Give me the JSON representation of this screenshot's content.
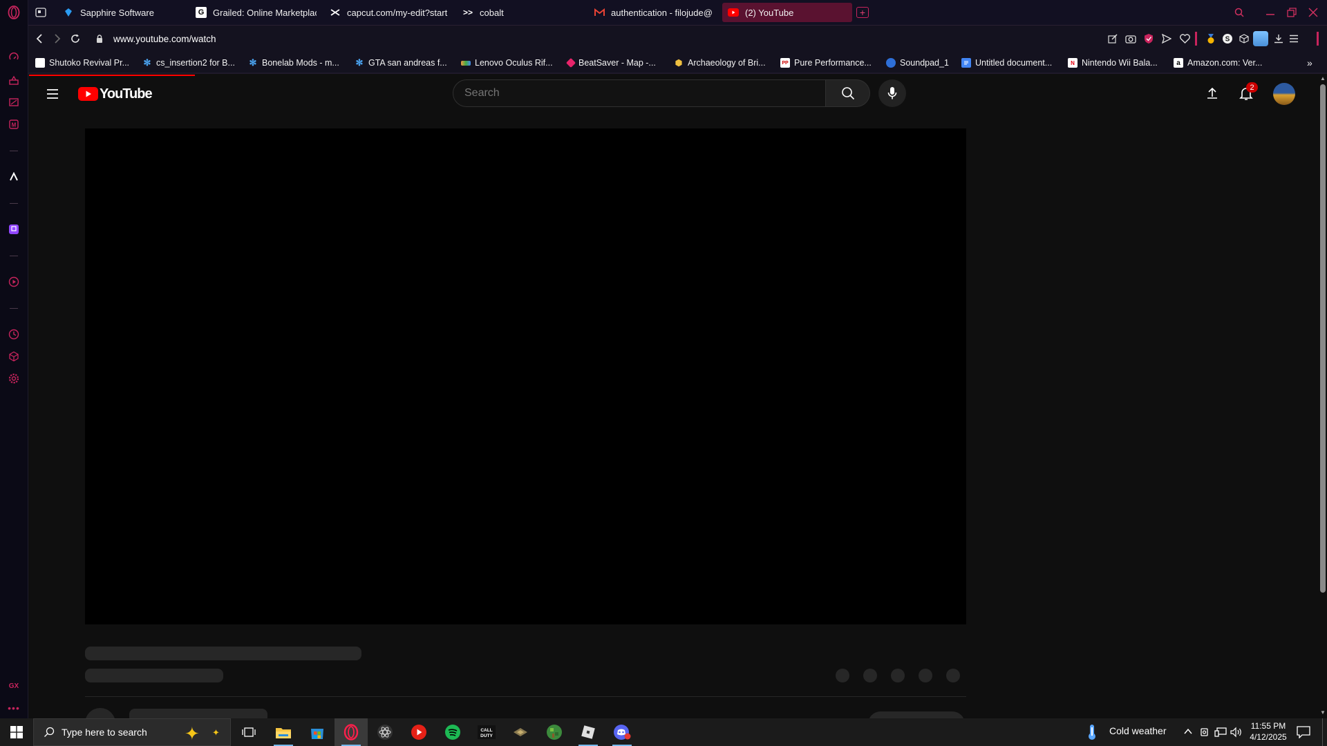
{
  "browser": {
    "tabs": [
      {
        "label": "Sapphire Software",
        "favicon": "sapphire-icon",
        "active": false
      },
      {
        "label": "Grailed: Online Marketplace",
        "favicon": "grailed-icon",
        "active": false
      },
      {
        "label": "capcut.com/my-edit?start",
        "favicon": "capcut-icon",
        "active": false
      },
      {
        "label": "cobalt",
        "favicon": "cobalt-icon",
        "active": false
      },
      {
        "label": "authentication - filojude@",
        "favicon": "gmail-icon",
        "active": false
      },
      {
        "label": "(2) YouTube",
        "favicon": "youtube-icon",
        "active": true
      }
    ],
    "address": "www.youtube.com/watch",
    "bookmarks": [
      {
        "label": "Shutoko Revival Pr...",
        "favicon": "page-icon"
      },
      {
        "label": "cs_insertion2 for B...",
        "favicon": "gear-icon"
      },
      {
        "label": "Bonelab Mods - m...",
        "favicon": "gear-icon"
      },
      {
        "label": "GTA san andreas f...",
        "favicon": "gear-icon"
      },
      {
        "label": "Lenovo Oculus Rif...",
        "favicon": "lenovo-icon"
      },
      {
        "label": "BeatSaver - Map -...",
        "favicon": "beatsaver-icon"
      },
      {
        "label": "Archaeology of Bri...",
        "favicon": "hexagon-icon"
      },
      {
        "label": "Pure Performance...",
        "favicon": "pure-icon"
      },
      {
        "label": "Soundpad_1",
        "favicon": "soundpad-icon"
      },
      {
        "label": "Untitled document...",
        "favicon": "docs-icon"
      },
      {
        "label": "Nintendo Wii Bala...",
        "favicon": "nintendo-icon"
      },
      {
        "label": "Amazon.com: Ver...",
        "favicon": "amazon-icon"
      }
    ]
  },
  "youtube": {
    "logo_text": "YouTube",
    "search_placeholder": "Search",
    "notification_count": "2"
  },
  "taskbar": {
    "search_placeholder": "Type here to search",
    "weather": "Cold weather",
    "time": "11:55 PM",
    "date": "4/12/2025"
  },
  "colors": {
    "accent": "#d0305f",
    "youtube_red": "#ff0000",
    "page_bg": "#0f0f0f",
    "skeleton": "#272727"
  }
}
